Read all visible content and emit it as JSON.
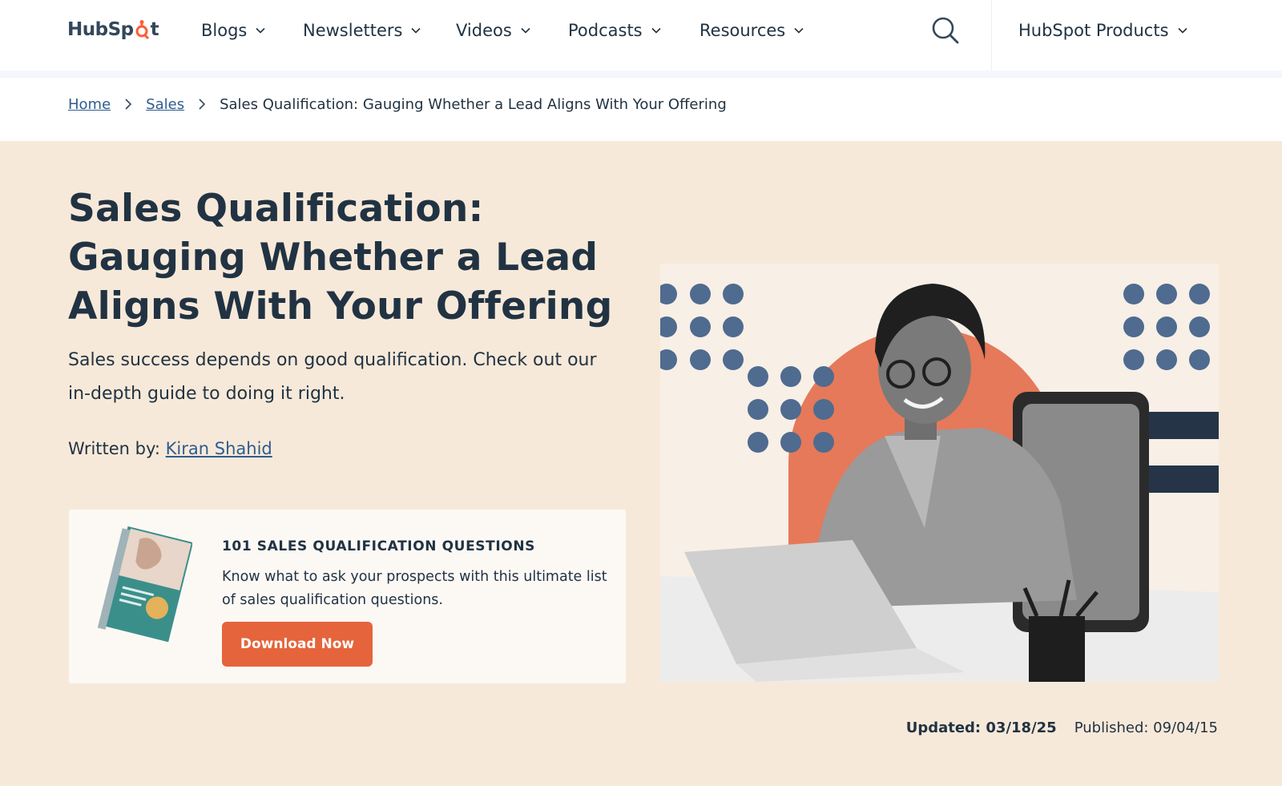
{
  "brand": {
    "logo_text_left": "HubSp",
    "logo_text_right": "t",
    "accent": "#ff5c35"
  },
  "nav": {
    "items": [
      {
        "label": "Blogs"
      },
      {
        "label": "Newsletters"
      },
      {
        "label": "Videos"
      },
      {
        "label": "Podcasts"
      },
      {
        "label": "Resources"
      }
    ],
    "search_icon": "search-icon",
    "products_label": "HubSpot Products"
  },
  "breadcrumb": {
    "items": [
      {
        "label": "Home"
      },
      {
        "label": "Sales"
      }
    ],
    "current": "Sales Qualification: Gauging Whether a Lead Aligns With Your Offering"
  },
  "article": {
    "title": "Sales Qualification: Gauging Whether a Lead Aligns With Your Offering",
    "subtitle": "Sales success depends on good qualification. Check out our in-depth guide to doing it right.",
    "byline_prefix": "Written by:",
    "author": "Kiran Shahid",
    "updated": "Updated: 03/18/25",
    "published": "Published: 09/04/15"
  },
  "cta": {
    "title": "101 SALES QUALIFICATION QUESTIONS",
    "description": "Know what to ask your prospects with this ultimate list of sales qualification questions.",
    "button_label": "Download Now",
    "button_color": "#e5643b"
  },
  "colors": {
    "hero_bg": "#f7e9d9",
    "text": "#213343",
    "link": "#2e5d8f",
    "dot": "#4f6b8f",
    "circle": "#e5795a"
  }
}
